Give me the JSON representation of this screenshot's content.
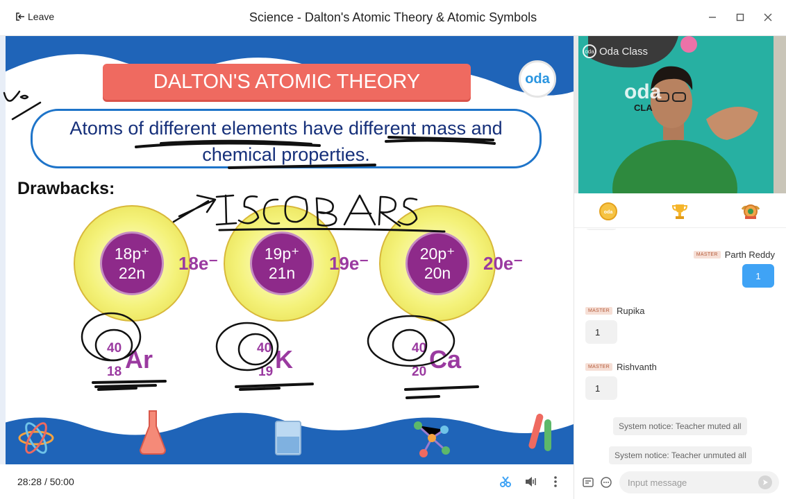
{
  "window": {
    "leave_label": "Leave",
    "title": "Science - Dalton's Atomic Theory & Atomic Symbols"
  },
  "slide": {
    "banner": "DALTON'S ATOMIC THEORY",
    "brand": "oda",
    "statement_line1": "Atoms of different elements have different mass and",
    "statement_line2": "chemical properties.",
    "drawbacks": "Drawbacks:",
    "atoms": [
      {
        "protons": "18p⁺",
        "neutrons": "22n",
        "electrons": "18e⁻",
        "mass": "40",
        "number": "18",
        "symbol": "Ar"
      },
      {
        "protons": "19p⁺",
        "neutrons": "21n",
        "electrons": "19e⁻",
        "mass": "40",
        "number": "19",
        "symbol": "K"
      },
      {
        "protons": "20p⁺",
        "neutrons": "20n",
        "electrons": "20e⁻",
        "mass": "40",
        "number": "20",
        "symbol": "Ca"
      }
    ]
  },
  "video": {
    "watermark": "Oda Class",
    "logo_text": "oda",
    "logo_sub": "CLA"
  },
  "chat": {
    "messages": [
      {
        "name": "Parth Reddy",
        "tag": "MASTER",
        "text": "1",
        "self": true
      },
      {
        "name": "Rupika",
        "tag": "MASTER",
        "text": "1",
        "self": false
      },
      {
        "name": "Rishvanth",
        "tag": "MASTER",
        "text": "1",
        "self": false
      }
    ],
    "notices": [
      "System notice: Teacher muted all",
      "System notice: Teacher unmuted all"
    ],
    "input_placeholder": "Input message"
  },
  "player": {
    "elapsed": "28:28",
    "separator": "/",
    "total": "50:00"
  },
  "colors": {
    "banner": "#ef6a60",
    "wave_blue": "#1f64b8",
    "atom_nucleus": "#8e2a8a",
    "chat_self": "#3fa3f5"
  }
}
